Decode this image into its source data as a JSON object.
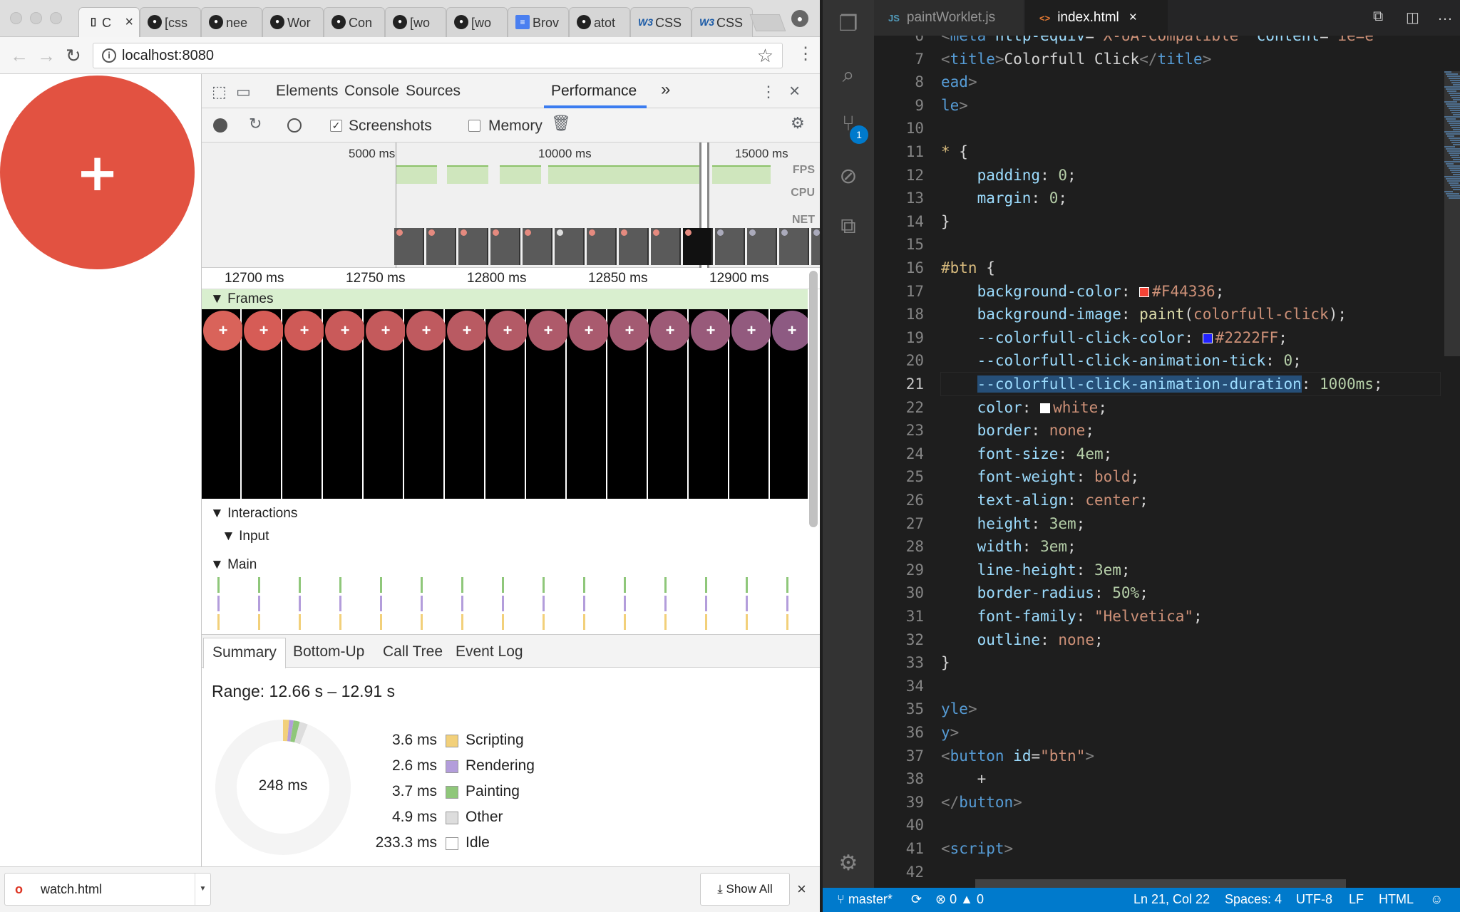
{
  "browser": {
    "tabs": [
      {
        "label": "C",
        "icon": "page-icon"
      },
      {
        "label": "[css",
        "icon": "github-icon"
      },
      {
        "label": "nee",
        "icon": "github-icon"
      },
      {
        "label": "Wor",
        "icon": "github-icon"
      },
      {
        "label": "Con",
        "icon": "github-icon"
      },
      {
        "label": "[wo",
        "icon": "github-icon"
      },
      {
        "label": "[wo",
        "icon": "github-icon"
      },
      {
        "label": "Brov",
        "icon": "docs-icon"
      },
      {
        "label": "atot",
        "icon": "github-icon"
      },
      {
        "label": "CSS",
        "icon": "w3c-icon"
      },
      {
        "label": "CSS",
        "icon": "w3c-icon"
      }
    ],
    "url": "localhost:8080",
    "page_button_label": "+"
  },
  "devtools": {
    "panels": [
      "Elements",
      "Console",
      "Sources",
      "Performance"
    ],
    "more": "»",
    "controls": {
      "screenshots": "Screenshots",
      "memory": "Memory"
    },
    "overview_ticks": [
      "5000 ms",
      "10000 ms",
      "15000 ms"
    ],
    "lanes": [
      "FPS",
      "CPU",
      "NET"
    ],
    "ruler_ticks": [
      "12700 ms",
      "12750 ms",
      "12800 ms",
      "12850 ms",
      "12900 ms"
    ],
    "tracks": {
      "frames": "Frames",
      "interactions": "Interactions",
      "input": "Input",
      "main": "Main"
    },
    "summary_tabs": [
      "Summary",
      "Bottom-Up",
      "Call Tree",
      "Event Log"
    ],
    "range": "Range: 12.66 s – 12.91 s",
    "total": "248 ms",
    "breakdown": [
      {
        "value": "3.6 ms",
        "name": "Scripting",
        "color": "#f2d07a",
        "ms": 3.6
      },
      {
        "value": "2.6 ms",
        "name": "Rendering",
        "color": "#b39ddb",
        "ms": 2.6
      },
      {
        "value": "3.7 ms",
        "name": "Painting",
        "color": "#8fc77a",
        "ms": 3.7
      },
      {
        "value": "4.9 ms",
        "name": "Other",
        "color": "#dddddd",
        "ms": 4.9
      },
      {
        "value": "233.3 ms",
        "name": "Idle",
        "color": "#ffffff",
        "ms": 233.3
      }
    ]
  },
  "downloads": {
    "file": "watch.html",
    "show_all": "Show All",
    "close": "×"
  },
  "vscode": {
    "tabs": [
      {
        "icon": "JS",
        "label": "paintWorklet.js"
      },
      {
        "icon": "<>",
        "label": "index.html",
        "close": "×"
      }
    ],
    "scm_badge": "1",
    "status": {
      "branch": "master*",
      "errors": "0",
      "warnings": "0",
      "position": "Ln 21, Col 22",
      "spaces": "Spaces: 4",
      "encoding": "UTF-8",
      "eol": "LF",
      "language": "HTML"
    },
    "lines": [
      {
        "n": "6",
        "html": "<span class='p'>&lt;</span><span class='t'>meta</span> <span class='k'>http-equiv</span>=<span class='s'>\"X-UA-Compatible\"</span> <span class='k'>content</span>=<span class='s'>\"ie=e</span>"
      },
      {
        "n": "7",
        "html": "<span class='p'>&lt;</span><span class='t'>title</span><span class='p'>&gt;</span>Colorfull Click<span class='p'>&lt;/</span><span class='t'>title</span><span class='p'>&gt;</span>"
      },
      {
        "n": "8",
        "html": "<span class='t'>ead</span><span class='p'>&gt;</span>"
      },
      {
        "n": "9",
        "html": "<span class='t'>le</span><span class='p'>&gt;</span>"
      },
      {
        "n": "10",
        "html": ""
      },
      {
        "n": "11",
        "html": "<span class='sel'>*</span> {"
      },
      {
        "n": "12",
        "html": "    <span class='k'>padding</span>: <span class='v'>0</span>;"
      },
      {
        "n": "13",
        "html": "    <span class='k'>margin</span>: <span class='v'>0</span>;"
      },
      {
        "n": "14",
        "html": "}"
      },
      {
        "n": "15",
        "html": ""
      },
      {
        "n": "16",
        "html": "<span class='sel'>#btn</span> {"
      },
      {
        "n": "17",
        "html": "    <span class='k'>background-color</span>: <span class='swatch' style='background:#F44336'></span><span class='s'>#F44336</span>;"
      },
      {
        "n": "18",
        "html": "    <span class='k'>background-image</span>: <span class='f'>paint</span>(<span class='s'>colorfull-click</span>);"
      },
      {
        "n": "19",
        "html": "    <span class='k'>--colorfull-click-color</span>: <span class='swatch' style='background:#2222FF'></span><span class='s'>#2222FF</span>;"
      },
      {
        "n": "20",
        "html": "    <span class='k'>--colorfull-click-animation-tick</span>: <span class='v'>0</span>;"
      },
      {
        "n": "21",
        "html": "    <span class='k' style='background:#264f78'>--colorfull-click-animation-duration</span>: <span class='v'>1000ms</span>;"
      },
      {
        "n": "22",
        "html": "    <span class='k'>color</span>: <span class='swatch' style='background:#ffffff'></span><span class='s'>white</span>;"
      },
      {
        "n": "23",
        "html": "    <span class='k'>border</span>: <span class='s'>none</span>;"
      },
      {
        "n": "24",
        "html": "    <span class='k'>font-size</span>: <span class='v'>4em</span>;"
      },
      {
        "n": "25",
        "html": "    <span class='k'>font-weight</span>: <span class='s'>bold</span>;"
      },
      {
        "n": "26",
        "html": "    <span class='k'>text-align</span>: <span class='s'>center</span>;"
      },
      {
        "n": "27",
        "html": "    <span class='k'>height</span>: <span class='v'>3em</span>;"
      },
      {
        "n": "28",
        "html": "    <span class='k'>width</span>: <span class='v'>3em</span>;"
      },
      {
        "n": "29",
        "html": "    <span class='k'>line-height</span>: <span class='v'>3em</span>;"
      },
      {
        "n": "30",
        "html": "    <span class='k'>border-radius</span>: <span class='v'>50%</span>;"
      },
      {
        "n": "31",
        "html": "    <span class='k'>font-family</span>: <span class='s'>\"Helvetica\"</span>;"
      },
      {
        "n": "32",
        "html": "    <span class='k'>outline</span>: <span class='s'>none</span>;"
      },
      {
        "n": "33",
        "html": "}"
      },
      {
        "n": "34",
        "html": ""
      },
      {
        "n": "35",
        "html": "<span class='t'>yle</span><span class='p'>&gt;</span>"
      },
      {
        "n": "36",
        "html": "<span class='t'>y</span><span class='p'>&gt;</span>"
      },
      {
        "n": "37",
        "html": "<span class='p'>&lt;</span><span class='t'>button</span> <span class='k'>id</span>=<span class='s'>\"btn\"</span><span class='p'>&gt;</span>"
      },
      {
        "n": "38",
        "html": "    +"
      },
      {
        "n": "39",
        "html": "<span class='p'>&lt;/</span><span class='t'>button</span><span class='p'>&gt;</span>"
      },
      {
        "n": "40",
        "html": ""
      },
      {
        "n": "41",
        "html": "<span class='p'>&lt;</span><span class='t'>script</span><span class='p'>&gt;</span>"
      },
      {
        "n": "42",
        "html": ""
      }
    ]
  }
}
